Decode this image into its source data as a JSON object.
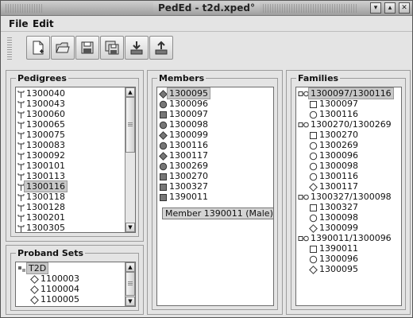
{
  "window": {
    "title": "PedEd - t2d.xped°"
  },
  "menu": [
    {
      "label": "File"
    },
    {
      "label": "Edit"
    }
  ],
  "toolbar": [
    {
      "icon": "new-file-icon"
    },
    {
      "icon": "open-folder-icon"
    },
    {
      "icon": "save-icon"
    },
    {
      "icon": "save-as-icon"
    },
    {
      "icon": "import-icon"
    },
    {
      "icon": "export-icon"
    }
  ],
  "pedigrees": {
    "title": "Pedigrees",
    "items": [
      "1300040",
      "1300043",
      "1300060",
      "1300065",
      "1300075",
      "1300083",
      "1300092",
      "1300101",
      "1300113",
      "1300116",
      "1300118",
      "1300128",
      "1300201",
      "1300305"
    ],
    "selected": "1300116"
  },
  "proband_sets": {
    "title": "Proband Sets",
    "root": "T2D",
    "items": [
      "1100003",
      "1100004",
      "1100005"
    ]
  },
  "members": {
    "title": "Members",
    "items": [
      {
        "id": "1300095",
        "shape": "diamond"
      },
      {
        "id": "1300096",
        "shape": "circle"
      },
      {
        "id": "1300097",
        "shape": "square"
      },
      {
        "id": "1300098",
        "shape": "circle"
      },
      {
        "id": "1300099",
        "shape": "diamond"
      },
      {
        "id": "1300116",
        "shape": "circle"
      },
      {
        "id": "1300117",
        "shape": "diamond"
      },
      {
        "id": "1300269",
        "shape": "circle"
      },
      {
        "id": "1300270",
        "shape": "square"
      },
      {
        "id": "1300327",
        "shape": "square"
      },
      {
        "id": "1390011",
        "shape": "square"
      }
    ],
    "selected": "1300095",
    "tooltip": "Member 1390011 (Male)"
  },
  "families": {
    "title": "Families",
    "groups": [
      {
        "label": "1300097/1300116",
        "children": [
          {
            "id": "1300097",
            "shape": "square"
          },
          {
            "id": "1300116",
            "shape": "circle"
          }
        ]
      },
      {
        "label": "1300270/1300269",
        "children": [
          {
            "id": "1300270",
            "shape": "square"
          },
          {
            "id": "1300269",
            "shape": "circle"
          },
          {
            "id": "1300096",
            "shape": "circle"
          },
          {
            "id": "1300098",
            "shape": "circle"
          },
          {
            "id": "1300116",
            "shape": "circle"
          },
          {
            "id": "1300117",
            "shape": "diamond"
          }
        ]
      },
      {
        "label": "1300327/1300098",
        "children": [
          {
            "id": "1300327",
            "shape": "square"
          },
          {
            "id": "1300098",
            "shape": "circle"
          },
          {
            "id": "1300099",
            "shape": "diamond"
          }
        ]
      },
      {
        "label": "1390011/1300096",
        "children": [
          {
            "id": "1390011",
            "shape": "square"
          },
          {
            "id": "1300096",
            "shape": "circle"
          },
          {
            "id": "1300095",
            "shape": "diamond"
          }
        ]
      }
    ],
    "selected": "1300097/1300116"
  }
}
